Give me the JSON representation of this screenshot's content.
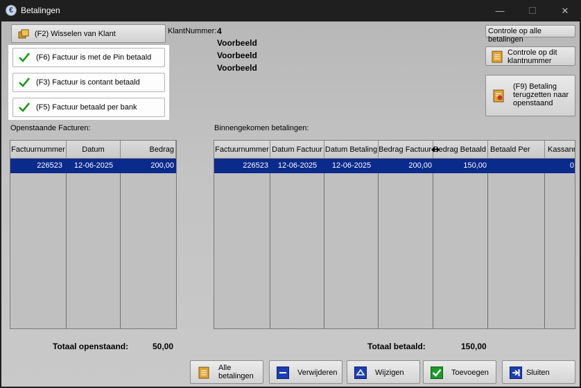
{
  "window": {
    "title": "Betalingen"
  },
  "buttons": {
    "wissel_klant": "(F2) Wisselen van Klant",
    "pin": "(F6) Factuur is met de Pin betaald",
    "contant": "(F3) Factuur is contant betaald",
    "bank": "(F5) Factuur betaald per bank",
    "controle_alle": "Controle op alle betalingen",
    "controle_klant": "Controle op dit klantnummer",
    "terugzetten": "(F9) Betaling terugzetten naar openstaand",
    "alle_betalingen": "Alle betalingen",
    "verwijderen": "Verwijderen",
    "wijzigen": "Wijzigen",
    "toevoegen": "Toevoegen",
    "sluiten": "Sluiten"
  },
  "client": {
    "label": "KlantNummer:",
    "number": "4",
    "line1": "Voorbeeld",
    "line2": "Voorbeeld",
    "line3": "Voorbeeld"
  },
  "open_invoices": {
    "title": "Openstaande Facturen:",
    "columns": [
      "Factuurnummer",
      "Datum",
      "Bedrag"
    ],
    "rows": [
      [
        "226523",
        "12-06-2025",
        "200,00"
      ]
    ],
    "total_label": "Totaal openstaand:",
    "total_value": "50,00"
  },
  "payments": {
    "title": "Binnengekomen betalingen:",
    "columns": [
      "Factuurnummer",
      "Datum Factuur",
      "Datum Betaling",
      "Bedrag Factuur",
      "Bedrag Betaald",
      "Betaald Per",
      "Kassanr"
    ],
    "rows": [
      [
        "226523",
        "12-06-2025",
        "12-06-2025",
        "200,00",
        "150,00",
        "",
        "0"
      ]
    ],
    "total_label": "Totaal betaald:",
    "total_value": "150,00"
  },
  "colors": {
    "selection": "#0a2a8c",
    "check": "#1a9a1a"
  }
}
